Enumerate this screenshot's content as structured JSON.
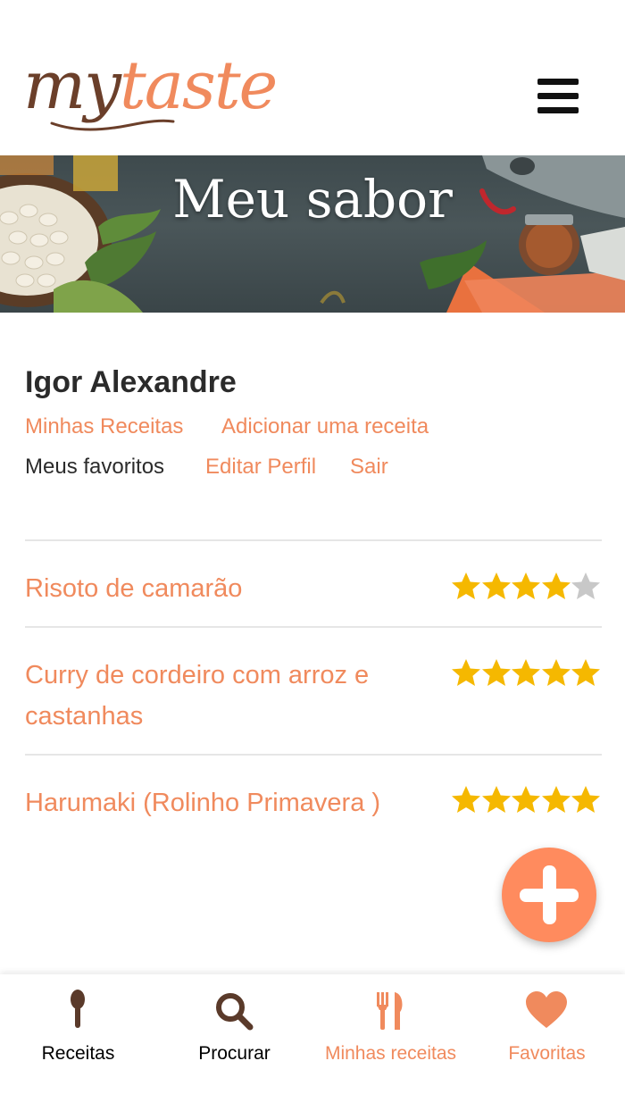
{
  "header": {
    "logo": {
      "part1": "my",
      "part2": "taste"
    },
    "menu_icon": "hamburger-menu-icon"
  },
  "banner": {
    "title": "Meu sabor"
  },
  "profile": {
    "name": "Igor Alexandre",
    "links": [
      {
        "label": "Minhas Receitas",
        "active": false
      },
      {
        "label": "Adicionar uma receita",
        "active": false
      },
      {
        "label": "Meus favoritos",
        "active": true
      },
      {
        "label": "Editar Perfil",
        "active": false
      },
      {
        "label": "Sair",
        "active": false
      }
    ]
  },
  "recipes": [
    {
      "title": "Risoto de camarão",
      "rating": 4,
      "max_rating": 5
    },
    {
      "title": "Curry de cordeiro com arroz e castanhas",
      "rating": 5,
      "max_rating": 5
    },
    {
      "title": "Harumaki (Rolinho Primavera )",
      "rating": 5,
      "max_rating": 5
    }
  ],
  "fab": {
    "icon": "plus-icon"
  },
  "bottom_nav": [
    {
      "label": "Receitas",
      "icon": "spoon-icon",
      "active": false
    },
    {
      "label": "Procurar",
      "icon": "search-icon",
      "active": false
    },
    {
      "label": "Minhas receitas",
      "icon": "utensils-icon",
      "active": true
    },
    {
      "label": "Favoritas",
      "icon": "heart-icon",
      "active": true
    }
  ],
  "colors": {
    "accent": "#f08a5d",
    "fab": "#ff8b5e",
    "brown": "#6b3f2a",
    "star_on": "#f5b800",
    "star_off": "#c8c8c8",
    "text_dark": "#2b2b2b"
  }
}
